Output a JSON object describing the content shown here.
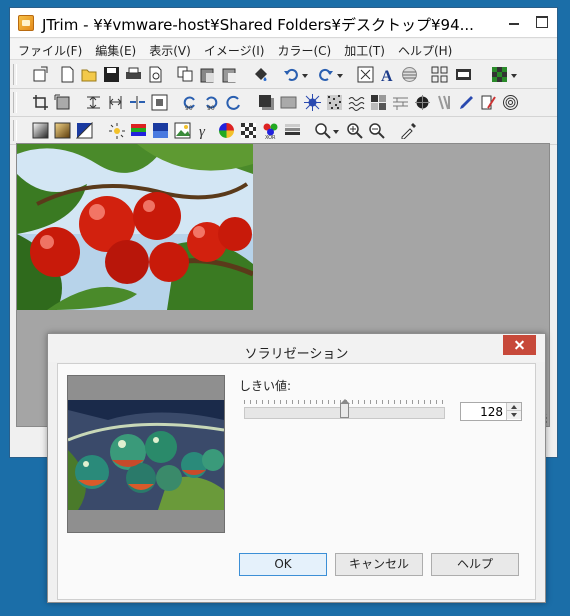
{
  "main_window": {
    "title": "JTrim - ¥¥vmware-host¥Shared Folders¥デスクトップ¥94..."
  },
  "menu": [
    {
      "label": "ファイル(F)"
    },
    {
      "label": "編集(E)"
    },
    {
      "label": "表示(V)"
    },
    {
      "label": "イメージ(I)"
    },
    {
      "label": "カラー(C)"
    },
    {
      "label": "加工(T)"
    },
    {
      "label": "ヘルプ(H)"
    }
  ],
  "toolbar_icons": {
    "row1": [
      "new-icon",
      "open-icon",
      "save-icon",
      "print-icon",
      "print-preview-icon",
      "copy-icon",
      "paste-icon",
      "paste-new-icon",
      "dropper-tool-icon",
      "undo-icon",
      "redo-icon",
      "fit-icon",
      "text-icon",
      "lines-icon",
      "grid-icon",
      "filmstrip-icon",
      "palette-icon"
    ],
    "row2": [
      "crop-icon",
      "resize-icon",
      "flip-vertical-icon",
      "flip-horizontal-icon",
      "split-icon",
      "frame-icon",
      "rotate-left-icon",
      "rotate-right-icon",
      "rotate-free-icon",
      "shadow-icon",
      "bevel-icon",
      "star-icon",
      "noise-icon",
      "wave-icon",
      "mosaic-icon",
      "brick-icon",
      "blur-icon",
      "stripe-icon",
      "pen-icon",
      "brush-icon",
      "spiral-icon"
    ],
    "row3": [
      "gray-icon",
      "sepia-icon",
      "negative-icon",
      "brightness-icon",
      "rgb-icon",
      "balance-icon",
      "picture-icon",
      "gamma-icon",
      "color-wheel-icon",
      "checker-icon",
      "xor-icon",
      "gradient-icon",
      "zoom-icon",
      "zoom-in-icon",
      "zoom-out-icon",
      "eyedropper-icon"
    ]
  },
  "dialog": {
    "title": "ソラリゼーション",
    "threshold_label": "しきい値:",
    "threshold_value": "128",
    "threshold_level": 0.5,
    "ok_label": "OK",
    "cancel_label": "キャンセル",
    "help_label": "ヘルプ"
  },
  "colors": {
    "desktop": "#1b6ea8",
    "close_button": "#c7493a",
    "canvas_bg": "#a5a5a5"
  }
}
